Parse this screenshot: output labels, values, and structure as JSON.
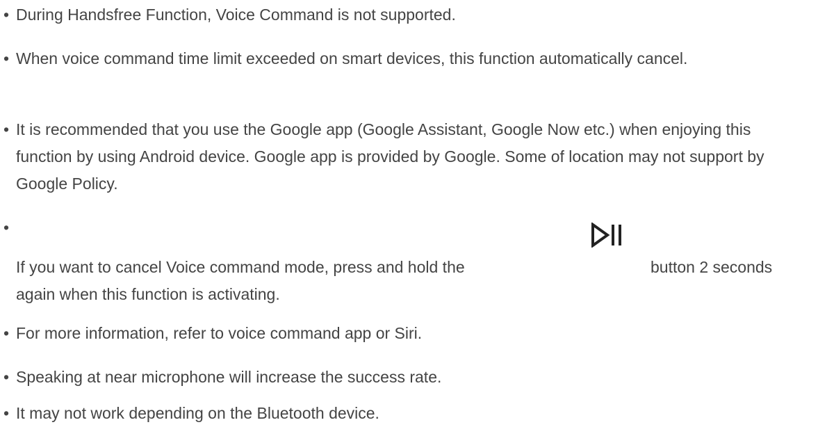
{
  "notes": [
    "During Handsfree Function, Voice Command is not supported.",
    "When voice command time limit exceeded on smart devices, this function automatically cancel.",
    "It is recommended that you use the Google app (Google Assistant, Google Now etc.) when enjoying this function by using Android device. Google app is provided by Google. Some of location may not support by Google Policy.",
    {
      "before_icon": "If you want to cancel Voice command mode, press and hold the",
      "icon": "play-pause-icon",
      "after_icon": "button 2 seconds",
      "continuation": "again when this function is activating."
    },
    "For more information, refer to voice command app or Siri.",
    "Speaking at near microphone will increase the success rate.",
    "It may not work depending on the Bluetooth device."
  ],
  "bullet": "•",
  "colors": {
    "text": "#444444",
    "icon": "#222222",
    "background": "#ffffff"
  }
}
